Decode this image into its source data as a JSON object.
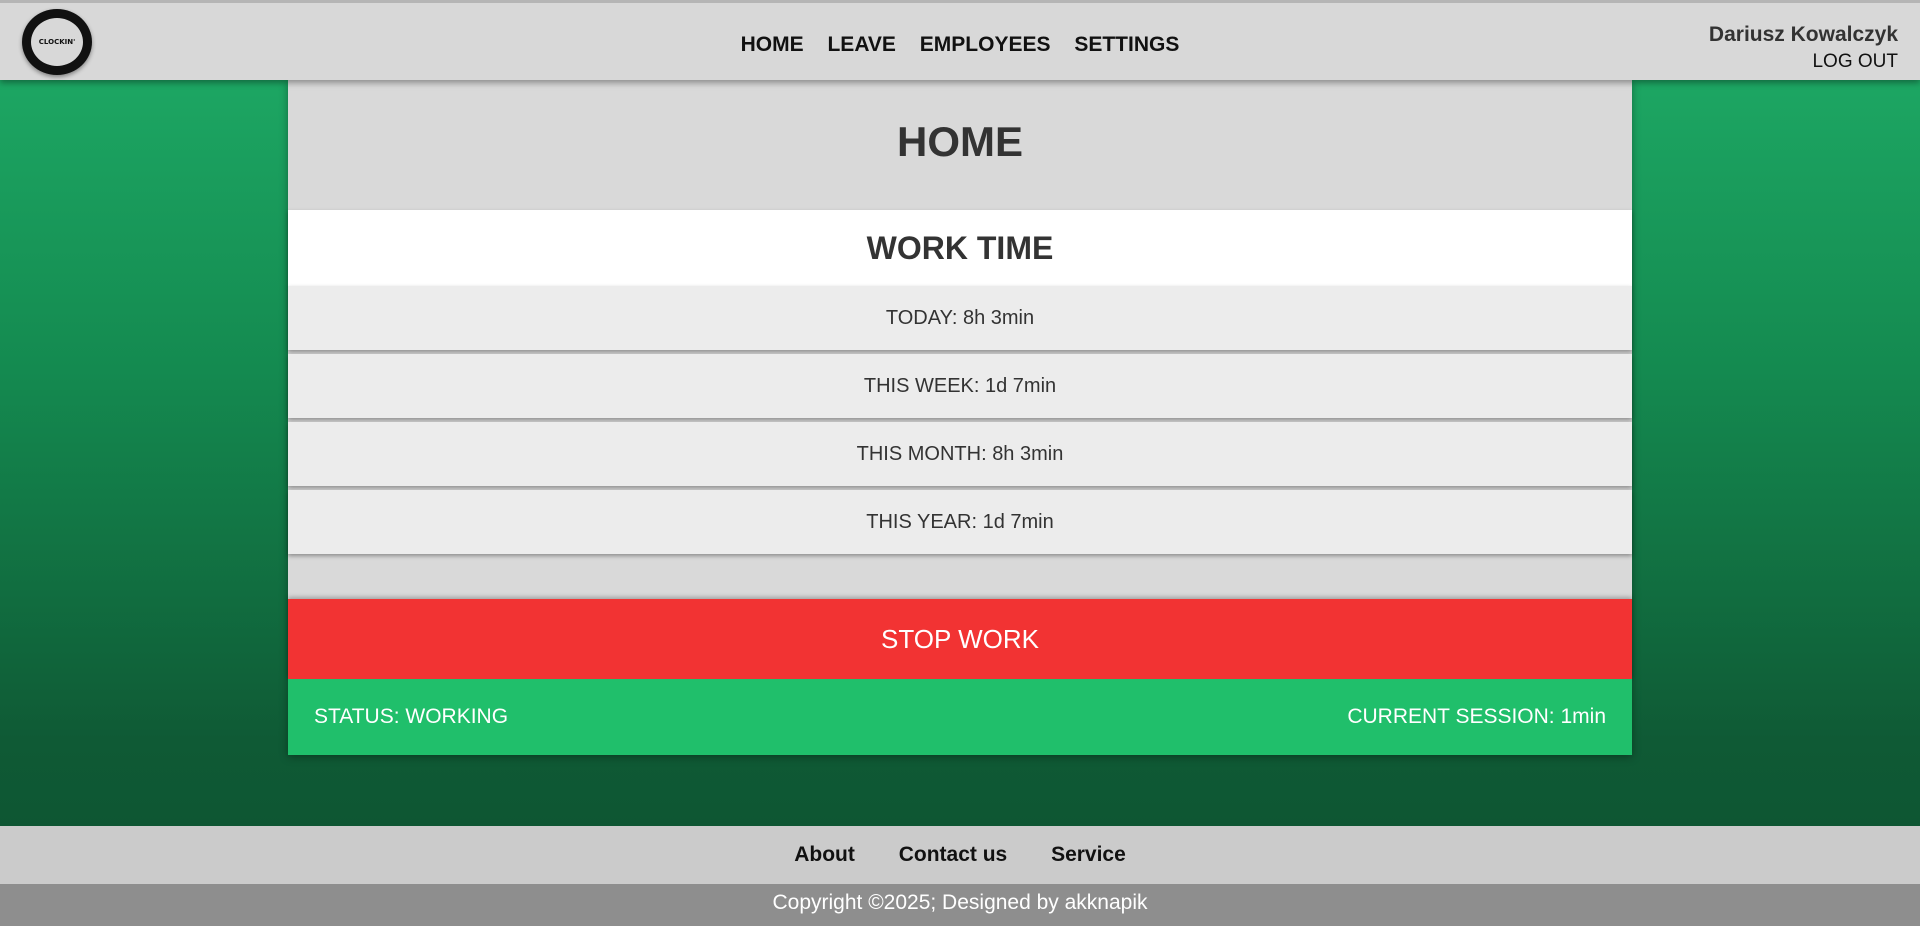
{
  "header": {
    "logo_text": "CLOCKIN'",
    "nav": [
      {
        "label": "HOME"
      },
      {
        "label": "LEAVE"
      },
      {
        "label": "EMPLOYEES"
      },
      {
        "label": "SETTINGS"
      }
    ],
    "user_name": "Dariusz Kowalczyk",
    "logout_label": "LOG OUT"
  },
  "main": {
    "page_title": "HOME",
    "section_title": "WORK TIME",
    "stats": [
      {
        "text": "TODAY: 8h 3min"
      },
      {
        "text": "THIS WEEK: 1d 7min"
      },
      {
        "text": "THIS MONTH: 8h 3min"
      },
      {
        "text": "THIS YEAR: 1d 7min"
      }
    ],
    "stop_button_label": "STOP WORK",
    "status_text": "STATUS: WORKING",
    "session_text": "CURRENT SESSION: 1min"
  },
  "footer": {
    "links": [
      {
        "label": "About"
      },
      {
        "label": "Contact us"
      },
      {
        "label": "Service"
      }
    ],
    "copyright": "Copyright ©2025; Designed by akknapik"
  },
  "colors": {
    "stop_button": "#f23333",
    "status_bar": "#20bf6b",
    "background_top": "#1fae68",
    "background_bottom": "#0d5230"
  }
}
